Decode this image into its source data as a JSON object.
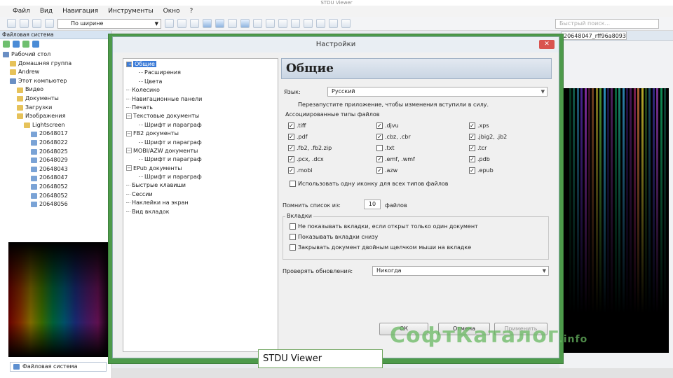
{
  "window": {
    "title": "STDU Viewer"
  },
  "menu": [
    "Файл",
    "Вид",
    "Навигация",
    "Инструменты",
    "Окно",
    "?"
  ],
  "toolbar": {
    "zoom_label": "По ширине",
    "quick_search_placeholder": "Быстрый поиск..."
  },
  "left_panel": {
    "header": "Файловая система",
    "tree": [
      {
        "label": "Рабочий стол",
        "icon": "pc",
        "indent": 0
      },
      {
        "label": "Домашняя группа",
        "icon": "folder",
        "indent": 1
      },
      {
        "label": "Andrew",
        "icon": "folder",
        "indent": 1
      },
      {
        "label": "Этот компьютер",
        "icon": "pc",
        "indent": 1
      },
      {
        "label": "Видео",
        "icon": "folder",
        "indent": 2
      },
      {
        "label": "Документы",
        "icon": "folder",
        "indent": 2
      },
      {
        "label": "Загрузки",
        "icon": "folder",
        "indent": 2
      },
      {
        "label": "Изображения",
        "icon": "folder",
        "indent": 2
      },
      {
        "label": "Lightscreen",
        "icon": "folder",
        "indent": 3
      },
      {
        "label": "20648017",
        "icon": "img",
        "indent": 4
      },
      {
        "label": "20648022",
        "icon": "img",
        "indent": 4
      },
      {
        "label": "20648025",
        "icon": "img",
        "indent": 4
      },
      {
        "label": "20648029",
        "icon": "img",
        "indent": 4
      },
      {
        "label": "20648043",
        "icon": "img",
        "indent": 4
      },
      {
        "label": "20648047",
        "icon": "img",
        "indent": 4
      },
      {
        "label": "20648052",
        "icon": "img",
        "indent": 4
      },
      {
        "label": "20648052",
        "icon": "img",
        "indent": 4
      },
      {
        "label": "20648056",
        "icon": "img",
        "indent": 4
      }
    ],
    "bottom_tab": "Файловая система"
  },
  "dialog": {
    "title": "Настройки",
    "tree": [
      {
        "label": "Общие",
        "level": 0,
        "expanded": true,
        "selected": true
      },
      {
        "label": "Расширения",
        "level": 1
      },
      {
        "label": "Цвета",
        "level": 1
      },
      {
        "label": "Колесико",
        "level": 0
      },
      {
        "label": "Навигационные панели",
        "level": 0
      },
      {
        "label": "Печать",
        "level": 0
      },
      {
        "label": "Текстовые документы",
        "level": 0,
        "expanded": true
      },
      {
        "label": "Шрифт и параграф",
        "level": 1
      },
      {
        "label": "FB2 документы",
        "level": 0,
        "expanded": true
      },
      {
        "label": "Шрифт и параграф",
        "level": 1
      },
      {
        "label": "MOBI/AZW документы",
        "level": 0,
        "expanded": true
      },
      {
        "label": "Шрифт и параграф",
        "level": 1
      },
      {
        "label": "EPub документы",
        "level": 0,
        "expanded": true
      },
      {
        "label": "Шрифт и параграф",
        "level": 1
      },
      {
        "label": "Быстрые клавиши",
        "level": 0
      },
      {
        "label": "Сессии",
        "level": 0
      },
      {
        "label": "Наклейки на экран",
        "level": 0
      },
      {
        "label": "Вид вкладок",
        "level": 0
      }
    ],
    "section_title": "Общие",
    "language_label": "Язык:",
    "language_value": "Русский",
    "restart_note": "Перезапустите приложение, чтобы изменения вступили в силу.",
    "assoc_label": "Ассоциированные типы файлов",
    "assoc": [
      {
        "label": ".tiff",
        "checked": true
      },
      {
        "label": ".djvu",
        "checked": true
      },
      {
        "label": ".xps",
        "checked": true
      },
      {
        "label": ".pdf",
        "checked": true
      },
      {
        "label": ".cbz, .cbr",
        "checked": true
      },
      {
        "label": ".jbig2, .jb2",
        "checked": true
      },
      {
        "label": ".fb2, .fb2.zip",
        "checked": true
      },
      {
        "label": ".txt",
        "checked": false
      },
      {
        "label": ".tcr",
        "checked": true
      },
      {
        "label": ".pcx, .dcx",
        "checked": true
      },
      {
        "label": ".emf, .wmf",
        "checked": true
      },
      {
        "label": ".pdb",
        "checked": true
      },
      {
        "label": ".mobi",
        "checked": true
      },
      {
        "label": ".azw",
        "checked": true
      },
      {
        "label": ".epub",
        "checked": true
      }
    ],
    "same_icon_label": "Использовать одну иконку для всех типов файлов",
    "remember_label": "Помнить список из:",
    "remember_value": "10",
    "remember_suffix": "файлов",
    "tabs_group_label": "Вкладки",
    "tab_options": [
      "Не показывать вкладки, если открыт только один документ",
      "Показывать вкладки снизу",
      "Закрывать документ двойным щелчком мыши на вкладке"
    ],
    "update_label": "Проверять обновления:",
    "update_value": "Никогда",
    "buttons": {
      "ok": "ОК",
      "cancel": "Отмена",
      "apply": "Применить"
    },
    "close_glyph": "✕"
  },
  "right_panel": {
    "tab_label": "20648047_rff96a8093"
  },
  "watermark": {
    "main": "СофтКаталог",
    "suffix": ".info"
  },
  "caption": "STDU Viewer"
}
